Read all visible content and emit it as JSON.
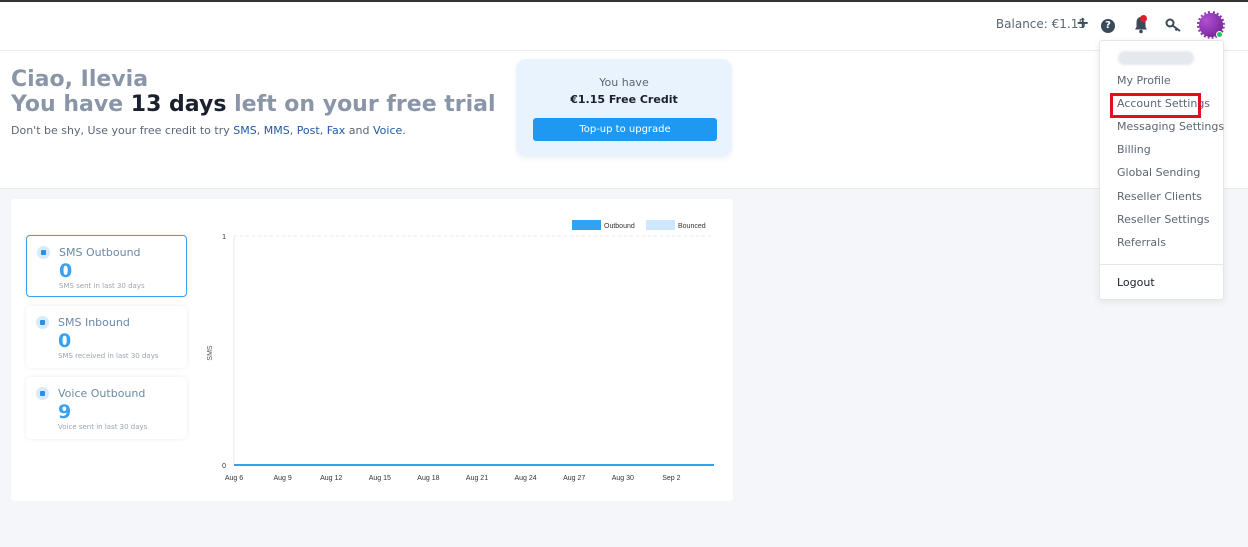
{
  "header": {
    "balance_label": "Balance: €1.15",
    "help_icon": "question-circle-icon",
    "notification_icon": "bell-icon",
    "key_icon": "key-icon",
    "colors": {
      "accent": "#1f98f2",
      "notification_dot": "#e11d2b",
      "status_online": "#22c55e"
    }
  },
  "hero": {
    "greeting": "Ciao, Ilevia",
    "trial_prefix": "You have ",
    "trial_days": "13 days",
    "trial_suffix": " left on your free trial",
    "hint_prefix": "Don't be shy, Use your free credit to try ",
    "hint_sms": "SMS",
    "hint_mms": "MMS",
    "hint_post": "Post",
    "hint_fax": "Fax",
    "hint_and": " and ",
    "hint_voice": "Voice."
  },
  "credit_card": {
    "line1": "You have",
    "line2": "€1.15 Free Credit",
    "button": "Top-up to upgrade"
  },
  "stats": [
    {
      "title": "SMS Outbound",
      "value": "0",
      "sub": "SMS sent in last 30 days",
      "active": true
    },
    {
      "title": "SMS Inbound",
      "value": "0",
      "sub": "SMS received in last 30 days",
      "active": false
    },
    {
      "title": "Voice Outbound",
      "value": "9",
      "sub": "Voice sent in last 30 days",
      "active": false
    }
  ],
  "chart_data": {
    "type": "area",
    "ylabel": "SMS",
    "ylim": [
      0,
      1
    ],
    "yticks": [
      "0",
      "1"
    ],
    "categories": [
      "Aug 6",
      "Aug 9",
      "Aug 12",
      "Aug 15",
      "Aug 18",
      "Aug 21",
      "Aug 24",
      "Aug 27",
      "Aug 30",
      "Sep 2"
    ],
    "series": [
      {
        "name": "Outbound",
        "color": "#2fa3f2",
        "values": [
          0,
          0,
          0,
          0,
          0,
          0,
          0,
          0,
          0,
          0
        ]
      },
      {
        "name": "Bounced",
        "color": "#cfe7fb",
        "values": [
          0,
          0,
          0,
          0,
          0,
          0,
          0,
          0,
          0,
          0
        ]
      }
    ],
    "legend": "top-right",
    "grid": true
  },
  "menu": {
    "items": [
      "My Profile",
      "Account Settings",
      "Messaging Settings",
      "Billing",
      "Global Sending",
      "Reseller Clients",
      "Reseller Settings",
      "Referrals"
    ],
    "logout": "Logout"
  }
}
